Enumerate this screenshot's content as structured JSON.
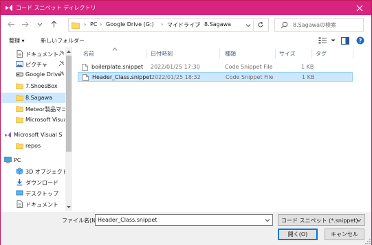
{
  "window": {
    "title": "コード スニペット ディレクトリ",
    "accent": "#d6247f"
  },
  "nav": {
    "path": [
      "PC",
      "Google Drive (G:)",
      "マイドライブ",
      "8.Sagawa"
    ],
    "search_placeholder": "8.Sagawaの検索"
  },
  "toolbar": {
    "organize": "整理 ▾",
    "new_folder": "新しいフォルダー"
  },
  "sidebar": {
    "items": [
      {
        "label": "ドキュメント",
        "icon": "document-icon",
        "pinned": true
      },
      {
        "label": "ピクチャ",
        "icon": "picture-icon",
        "pinned": true
      },
      {
        "label": "Google Drive",
        "icon": "drive-icon",
        "pinned": true
      },
      {
        "label": "7.ShoesBox",
        "icon": "folder-icon",
        "pinned": false
      },
      {
        "label": "8.Sagawa",
        "icon": "folder-icon",
        "pinned": false,
        "selected": true
      },
      {
        "label": "Meteor製品マニュ",
        "icon": "folder-icon",
        "pinned": false
      },
      {
        "label": "Microsoft Visual",
        "icon": "folder-icon",
        "pinned": false
      },
      {
        "label": "Microsoft Visual S",
        "icon": "visual-studio-icon",
        "top": true
      },
      {
        "label": "repos",
        "icon": "folder-icon",
        "pinned": false
      },
      {
        "label": "PC",
        "icon": "pc-icon",
        "top": true
      },
      {
        "label": "3D オブジェクト",
        "icon": "3d-objects-icon"
      },
      {
        "label": "ダウンロード",
        "icon": "download-icon"
      },
      {
        "label": "デスクトップ",
        "icon": "desktop-icon"
      },
      {
        "label": "ドキュメント",
        "icon": "document-icon"
      }
    ]
  },
  "columns": {
    "name": "名前",
    "date": "日付時刻",
    "type": "種類",
    "size": "サイズ",
    "tag": "タグ"
  },
  "files": [
    {
      "name": "boilerplate.snippet",
      "date": "2022/01/25 17:30",
      "type": "Code Snippet File",
      "size": "1 KB",
      "selected": false
    },
    {
      "name": "Header_Class.snippet",
      "date": "2022/01/25 18:32",
      "type": "Code Snippet File",
      "size": "1 KB",
      "selected": true
    }
  ],
  "footer": {
    "filename_label": "ファイル名(N):",
    "filename_value": "Header_Class.snippet",
    "filetype_value": "コード スニペット (*.snippet)",
    "open_label": "開く(O)",
    "cancel_label": "キャンセル"
  }
}
